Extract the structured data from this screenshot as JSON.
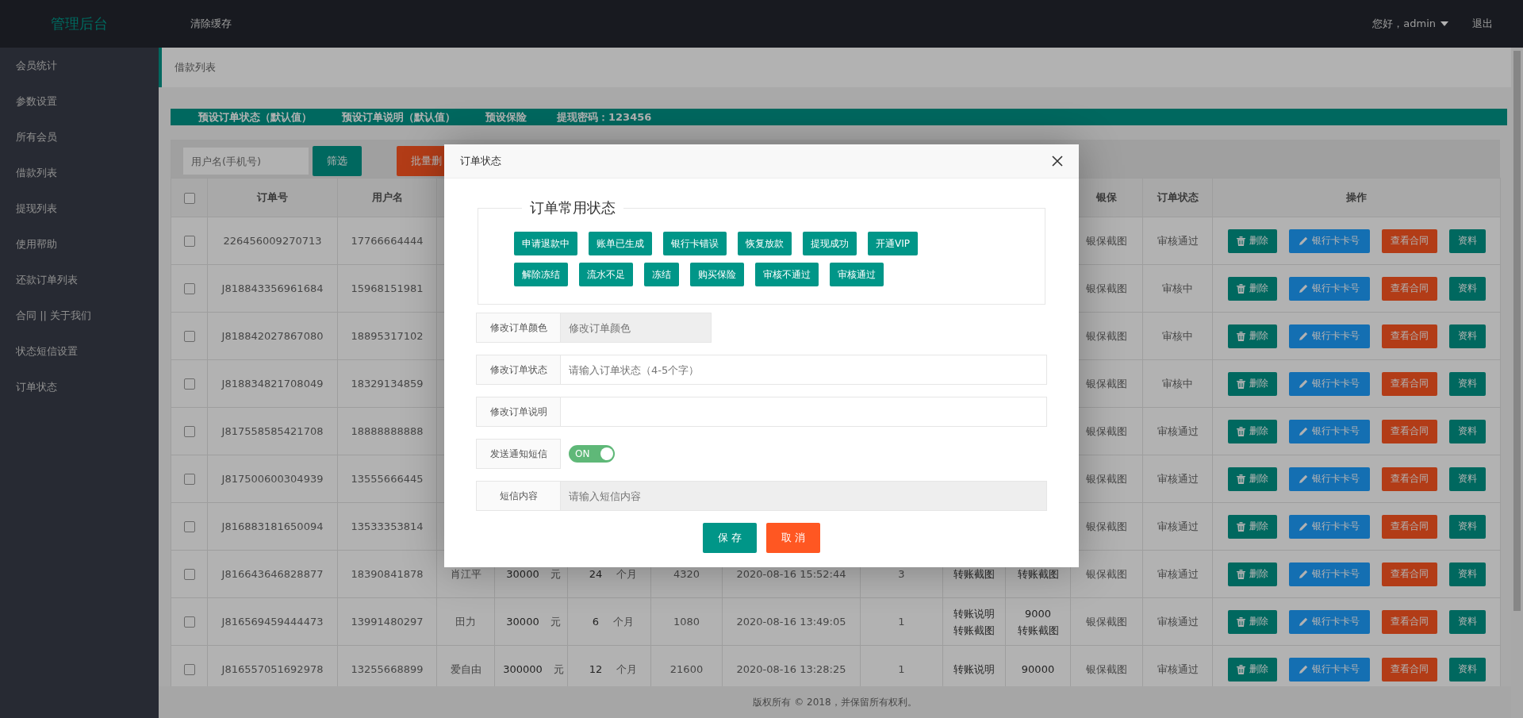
{
  "topbar": {
    "logo": "管理后台",
    "links": [
      "清除缓存"
    ],
    "user": "您好，admin",
    "logout": "退出"
  },
  "sidebar": {
    "items": [
      {
        "label": "会员统计",
        "selected": false
      },
      {
        "label": "参数设置",
        "selected": false
      },
      {
        "label": "所有会员",
        "selected": false
      },
      {
        "label": "借款列表",
        "selected": false
      },
      {
        "label": "提现列表",
        "selected": false
      },
      {
        "label": "使用帮助",
        "selected": false
      },
      {
        "label": "还款订单列表",
        "selected": false
      },
      {
        "label": "合同 || 关于我们",
        "selected": false
      },
      {
        "label": "状态短信设置",
        "selected": false
      },
      {
        "label": "订单状态",
        "selected": false
      }
    ]
  },
  "breadcrumb": "借款列表",
  "preset_bar": [
    "预设订单状态（默认值）",
    "预设订单说明（默认值）",
    "预设保险",
    "提现密码：123456"
  ],
  "toolbar": {
    "search": {
      "placeholder": "用户名(手机号)"
    },
    "filter_button": "筛选",
    "batch_delete_button": "批量删"
  },
  "table": {
    "header": {
      "checked": false,
      "order_no": "订单号",
      "username": "用户名",
      "guarantee": "银保",
      "status": "订单状态",
      "actions": "操作"
    },
    "rows": [
      {
        "checked": false,
        "order_no": "226456009270713",
        "username": "17766664444",
        "guarantee": "银保截图",
        "status": "审核通过",
        "actions": [
          "删除",
          "银行卡卡号",
          "查看合同",
          "资料"
        ]
      },
      {
        "checked": false,
        "order_no": "J818843356961684",
        "username": "15968151981",
        "guarantee": "银保截图",
        "status": "审核中",
        "actions": [
          "删除",
          "银行卡卡号",
          "查看合同",
          "资料"
        ]
      },
      {
        "checked": false,
        "order_no": "J818842027867080",
        "username": "18895317102",
        "guarantee": "银保截图",
        "status": "审核中",
        "actions": [
          "删除",
          "银行卡卡号",
          "查看合同",
          "资料"
        ]
      },
      {
        "checked": false,
        "order_no": "J818834821708049",
        "username": "18329134859",
        "guarantee": "银保截图",
        "status": "审核中",
        "actions": [
          "删除",
          "银行卡卡号",
          "查看合同",
          "资料"
        ]
      },
      {
        "checked": false,
        "order_no": "J817558585421708",
        "username": "18888888888",
        "guarantee": "银保截图",
        "status": "审核通过",
        "actions": [
          "删除",
          "银行卡卡号",
          "查看合同",
          "资料"
        ]
      },
      {
        "checked": false,
        "order_no": "J817500600304939",
        "username": "13555666445",
        "guarantee": "银保截图",
        "status": "审核通过",
        "actions": [
          "删除",
          "银行卡卡号",
          "查看合同",
          "资料"
        ]
      },
      {
        "checked": false,
        "order_no": "J816883181650094",
        "username": "13533353814",
        "guarantee": "银保截图",
        "status": "审核通过",
        "actions": [
          "删除",
          "银行卡卡号",
          "查看合同",
          "资料"
        ]
      },
      {
        "checked": false,
        "order_no": "J816643646828877",
        "username": "18390841878",
        "column_3": "肖江平",
        "column_4": {
          "value": "30000",
          "unit": "元"
        },
        "column_5": {
          "value": "24",
          "unit": "个月"
        },
        "column_6": "4320",
        "column_7": "2020-08-16 15:52:44",
        "column_8": "3",
        "column_9": [
          "转账截图"
        ],
        "column_10": [
          "转账截图"
        ],
        "guarantee": "银保截图",
        "status": "审核通过",
        "actions": [
          "删除",
          "银行卡卡号",
          "查看合同",
          "资料"
        ]
      },
      {
        "checked": false,
        "order_no": "J816569459444473",
        "username": "13991480297",
        "column_3": "田力",
        "column_4": {
          "value": "30000",
          "unit": "元"
        },
        "column_5": {
          "value": "6",
          "unit": "个月"
        },
        "column_6": "1080",
        "column_7": "2020-08-16 13:49:05",
        "column_8": "1",
        "column_9": [
          "转账说明",
          "转账截图"
        ],
        "column_10": [
          "9000",
          "转账截图"
        ],
        "guarantee": "银保截图",
        "status": "审核通过",
        "actions": [
          "删除",
          "银行卡卡号",
          "查看合同",
          "资料"
        ]
      },
      {
        "checked": false,
        "order_no": "J816557051692978",
        "username": "13255668899",
        "column_3": "爱自由",
        "column_4": {
          "value": "300000",
          "unit": "元"
        },
        "column_5": {
          "value": "12",
          "unit": "个月"
        },
        "column_6": "21600",
        "column_7": "2020-08-16 13:28:25",
        "column_8": "1",
        "column_9": [
          "转账说明"
        ],
        "column_10": [
          "90000"
        ],
        "guarantee": "银保截图",
        "status": "审核通过",
        "actions": [
          "删除",
          "银行卡卡号",
          "查看合同",
          "资料"
        ]
      }
    ]
  },
  "footer": "版权所有 © 2018，并保留所有权利。",
  "modal": {
    "title": "订单状态",
    "legend": "订单常用状态",
    "presets": [
      "申请退款中",
      "账单已生成",
      "银行卡错误",
      "恢复放款",
      "提现成功",
      "开通VIP",
      "解除冻结",
      "流水不足",
      "冻结",
      "购买保险",
      "审核不通过",
      "审核通过"
    ],
    "fields": [
      {
        "kind": "input",
        "label": "修改订单颜色",
        "placeholder": "修改订单颜色",
        "disabled": true,
        "short": true
      },
      {
        "kind": "input",
        "label": "修改订单状态",
        "placeholder": "请输入订单状态（4-5个字）",
        "disabled": false,
        "short": false
      },
      {
        "kind": "input",
        "label": "修改订单说明",
        "disabled": false,
        "short": false
      },
      {
        "kind": "switch",
        "label": "发送通知短信",
        "on": true,
        "text": "ON"
      },
      {
        "kind": "input",
        "label": "短信内容",
        "placeholder": "请输入短信内容",
        "disabled": true,
        "short": false
      }
    ],
    "save": "保 存",
    "cancel": "取 消"
  }
}
